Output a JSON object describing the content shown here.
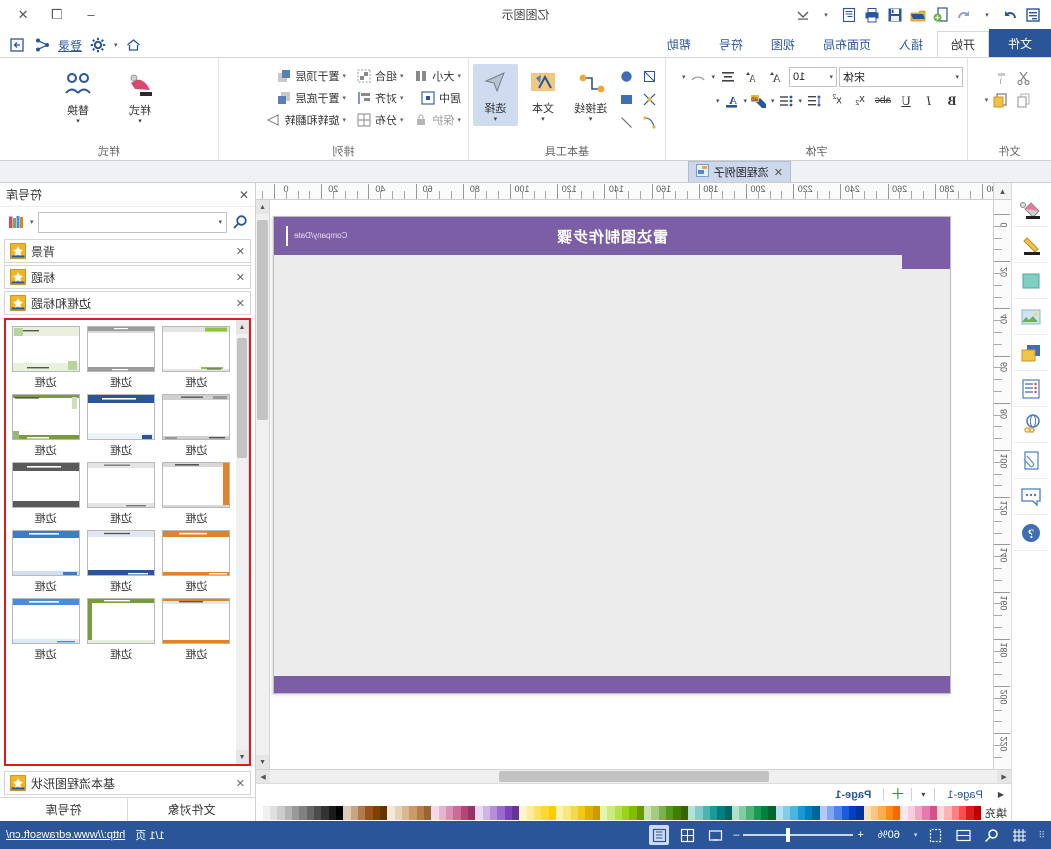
{
  "window": {
    "title": "亿图图示",
    "controls": {
      "minimize": "–",
      "maximize": "❐",
      "close": "✕"
    }
  },
  "quick_access": [
    {
      "name": "menu-icon",
      "label": "☰"
    },
    {
      "name": "redo-icon",
      "label": "↷"
    },
    {
      "name": "undo-dropdown-icon",
      "label": "▾"
    },
    {
      "name": "undo-icon",
      "label": "↶"
    },
    {
      "name": "new-icon",
      "label": "＋"
    },
    {
      "name": "open-icon",
      "label": "📂"
    },
    {
      "name": "save-icon",
      "label": "💾"
    },
    {
      "name": "print-icon",
      "label": "🖨"
    },
    {
      "name": "print-preview-icon",
      "label": "📄"
    },
    {
      "name": "customize-qat-icon",
      "label": "▾"
    }
  ],
  "ribbon_tabs": [
    {
      "label": "文件",
      "state": "file"
    },
    {
      "label": "开始",
      "state": "active"
    },
    {
      "label": "插入",
      "state": "normal"
    },
    {
      "label": "页面布局",
      "state": "normal"
    },
    {
      "label": "视图",
      "state": "normal"
    },
    {
      "label": "符号",
      "state": "normal"
    },
    {
      "label": "帮助",
      "state": "normal"
    }
  ],
  "tabbar_right": {
    "login_label": "登录",
    "share_icon": "share-icon",
    "settings_icon": "gear-icon",
    "home_icon": "home-icon",
    "home_dropdown": "▾"
  },
  "ribbon_groups": [
    {
      "name": "文件",
      "title": "文件",
      "buttons": [
        {
          "label": "复制",
          "name": "copy-button"
        },
        {
          "label": "粘贴",
          "name": "paste-button"
        },
        {
          "label": "格式刷",
          "name": "format-painter-button"
        },
        {
          "label": "剪切",
          "name": "cut-button"
        }
      ]
    },
    {
      "name": "字体",
      "title": "字体",
      "font_name": "宋体",
      "font_size": "10",
      "buttons": [
        {
          "label": "加粗",
          "name": "bold-button",
          "glyph": "B"
        },
        {
          "label": "倾斜",
          "name": "italic-button",
          "glyph": "I"
        },
        {
          "label": "下划线",
          "name": "underline-button",
          "glyph": "U"
        },
        {
          "label": "删除线",
          "name": "strikethrough-button",
          "glyph": "abc"
        },
        {
          "label": "上标",
          "name": "superscript-button",
          "glyph": "x²"
        },
        {
          "label": "下标",
          "name": "subscript-button",
          "glyph": "x₂"
        },
        {
          "label": "行距",
          "name": "line-spacing-button"
        },
        {
          "label": "项目符号",
          "name": "bullet-list-button"
        },
        {
          "label": "文本突出显示",
          "name": "highlight-button"
        },
        {
          "label": "字体颜色",
          "name": "font-color-button"
        },
        {
          "label": "增大字号",
          "name": "grow-font-button"
        },
        {
          "label": "减小字号",
          "name": "shrink-font-button"
        },
        {
          "label": "对齐",
          "name": "align-text-button"
        },
        {
          "label": "文字弯曲",
          "name": "curve-text-button"
        }
      ]
    },
    {
      "name": "基本工具",
      "title": "基本工具",
      "buttons": [
        {
          "label": "选择",
          "name": "select-tool-button",
          "selected": true
        },
        {
          "label": "文本",
          "name": "text-tool-button",
          "selected": false
        },
        {
          "label": "连接线",
          "name": "connector-tool-button",
          "selected": false
        }
      ],
      "shapes": [
        {
          "name": "curve-shape"
        },
        {
          "name": "line-shape"
        },
        {
          "name": "pencil-shape"
        },
        {
          "name": "rectangle-shape"
        },
        {
          "name": "anchor-shape"
        },
        {
          "name": "ellipse-shape"
        }
      ]
    },
    {
      "name": "排列",
      "title": "排列",
      "buttons": [
        {
          "label": "置于顶层",
          "name": "bring-to-front-button"
        },
        {
          "label": "置于底层",
          "name": "send-to-back-button"
        },
        {
          "label": "旋转和翻转",
          "name": "rotate-flip-button"
        },
        {
          "label": "组合",
          "name": "group-button"
        },
        {
          "label": "对齐",
          "name": "align-button"
        },
        {
          "label": "分布",
          "name": "distribute-button"
        },
        {
          "label": "大小",
          "name": "size-button"
        },
        {
          "label": "居中",
          "name": "center-button"
        },
        {
          "label": "保护",
          "name": "protect-button"
        }
      ]
    },
    {
      "name": "样式",
      "title": "样式",
      "buttons": [
        {
          "label": "样式",
          "name": "style-button"
        },
        {
          "label": "替换",
          "name": "replace-button"
        }
      ]
    }
  ],
  "doc_tab": {
    "label": "流程图例子",
    "close": "✕"
  },
  "left_rail": [
    {
      "name": "fill-icon",
      "label": "填充"
    },
    {
      "name": "line-icon",
      "label": "线条"
    },
    {
      "name": "shape-icon",
      "label": "形状"
    },
    {
      "name": "image-icon",
      "label": "图片"
    },
    {
      "name": "layer-icon",
      "label": "图层"
    },
    {
      "name": "list-icon",
      "label": "列表"
    },
    {
      "name": "hyperlink-icon",
      "label": "超链接"
    },
    {
      "name": "attachment-icon",
      "label": "附件"
    },
    {
      "name": "comment-icon",
      "label": "批注"
    },
    {
      "name": "help-icon",
      "label": "帮助"
    }
  ],
  "rulers": {
    "horizontal_ticks": [
      0,
      20,
      40,
      60,
      80,
      100,
      120,
      140,
      160,
      180,
      200,
      220,
      240,
      260,
      280,
      300
    ],
    "vertical_ticks": [
      0,
      20,
      40,
      60,
      80,
      100,
      120,
      140,
      160,
      180,
      200,
      220
    ]
  },
  "canvas": {
    "page_title": "雷达图制作步骤",
    "page_company": "Company/Date",
    "header_color": "#7c5ea6"
  },
  "right_panel": {
    "title": "符号库",
    "search_placeholder": "",
    "search_value": "",
    "libraries": [
      {
        "label": "背景",
        "name": "library-background"
      },
      {
        "label": "标题",
        "name": "library-title"
      },
      {
        "label": "边框和标题",
        "name": "library-border-title"
      }
    ],
    "bottom_library": {
      "label": "基本流程图形状",
      "name": "library-basic-flowchart"
    },
    "shapes": [
      {
        "caption": "边框",
        "accent": "#8cc63f",
        "style": "a"
      },
      {
        "caption": "边框",
        "accent": "#9a9a9a",
        "style": "b"
      },
      {
        "caption": "边框",
        "accent": "#b5d69a",
        "style": "c"
      },
      {
        "caption": "边框",
        "accent": "#aaaaaa",
        "style": "d"
      },
      {
        "caption": "边框",
        "accent": "#2a5699",
        "style": "e"
      },
      {
        "caption": "边框",
        "accent": "#7a9b3c",
        "style": "f"
      },
      {
        "caption": "边框",
        "accent": "#e0832a",
        "style": "g"
      },
      {
        "caption": "边框",
        "accent": "#bdbdbd",
        "style": "h"
      },
      {
        "caption": "边框",
        "accent": "#555555",
        "style": "i"
      },
      {
        "caption": "边框",
        "accent": "#e0832a",
        "style": "j"
      },
      {
        "caption": "边框",
        "accent": "#2a5699",
        "style": "k"
      },
      {
        "caption": "边框",
        "accent": "#3d7cc9",
        "style": "l"
      },
      {
        "caption": "边框",
        "accent": "#e0832a",
        "style": "m"
      },
      {
        "caption": "边框",
        "accent": "#7a9b3c",
        "style": "n"
      },
      {
        "caption": "边框",
        "accent": "#4a8fd4",
        "style": "o"
      }
    ],
    "tabs": [
      {
        "label": "符号库",
        "name": "tab-symbol-library",
        "active": true
      },
      {
        "label": "文件对象",
        "name": "tab-file-objects",
        "active": false
      }
    ]
  },
  "page_tabs": {
    "prev": "◀",
    "next": "▾",
    "add": "＋",
    "tabs": [
      {
        "label": "Page-1",
        "active": false
      },
      {
        "label": "Page-1",
        "active": true
      }
    ]
  },
  "palette": {
    "label": "填充",
    "colors": [
      "#c00000",
      "#e01b1b",
      "#ff4d4d",
      "#ff8080",
      "#ffb3b3",
      "#ffd9d9",
      "#d94f8c",
      "#e878ae",
      "#f0a5c8",
      "#f7cde0",
      "#ffe6f0",
      "#ff6600",
      "#ff8c1a",
      "#ffad4d",
      "#ffc680",
      "#ffdfb3",
      "#00339c",
      "#0040c1",
      "#1a5ce0",
      "#4d84ea",
      "#80a8f2",
      "#b3c9f7",
      "#006699",
      "#0080bf",
      "#1a9ad4",
      "#4db3e0",
      "#80cdea",
      "#b3e0f5",
      "#006633",
      "#008040",
      "#1a9a53",
      "#4db37a",
      "#80cca3",
      "#b3e0c9",
      "#006666",
      "#008080",
      "#1a9a9a",
      "#4db3b3",
      "#80cccc",
      "#b3e0e0",
      "#336600",
      "#408000",
      "#539a1a",
      "#7ab34d",
      "#a3cc80",
      "#c9e0b3",
      "#669900",
      "#80bf00",
      "#9ad41a",
      "#b3e04d",
      "#cceA80",
      "#e0f5b3",
      "#cc9900",
      "#e0b000",
      "#f0c81a",
      "#f5d84d",
      "#fae680",
      "#fdf0b3",
      "#ffcc00",
      "#ffd633",
      "#ffe066",
      "#ffeb99",
      "#fff5cc",
      "#663399",
      "#7d44b8",
      "#9a6acc",
      "#b68fdb",
      "#d1b5e8",
      "#e8daf4",
      "#993366",
      "#b8447d",
      "#cc6a9a",
      "#db8fb6",
      "#e8b5d1",
      "#f4daE8",
      "#996633",
      "#b87d44",
      "#cc9a6a",
      "#dbb68f",
      "#e8d1b5",
      "#f4e8da",
      "#663300",
      "#804000",
      "#9a531a",
      "#b37a4d",
      "#cca380",
      "#e0c9b3",
      "#000000",
      "#1a1a1a",
      "#333333",
      "#4d4d4d",
      "#666666",
      "#808080",
      "#999999",
      "#b3b3b3",
      "#cccccc",
      "#e0e0e0",
      "#f0f0f0",
      "#ffffff"
    ]
  },
  "status_bar": {
    "view_buttons": [
      {
        "name": "normal-view-button",
        "selected": true
      },
      {
        "name": "grid-view-button",
        "selected": false
      },
      {
        "name": "fullscreen-view-button",
        "selected": false
      }
    ],
    "zoom_out": "–",
    "zoom_in": "+",
    "zoom_level": "60%",
    "zoom_dropdown": "▾",
    "tool_icons": [
      {
        "name": "fit-page-icon"
      },
      {
        "name": "fit-width-icon"
      },
      {
        "name": "magnifier-icon"
      },
      {
        "name": "grid-toggle-icon"
      }
    ],
    "page_count": "1/1 页",
    "url": "http://www.edrawsoft.cn/"
  }
}
